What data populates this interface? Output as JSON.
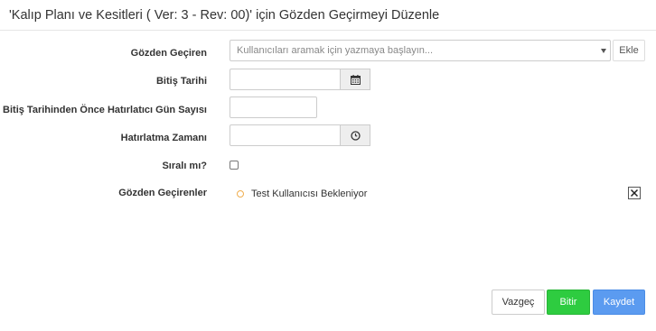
{
  "modal": {
    "title": "'Kalıp Planı ve Kesitleri ( Ver: 3 - Rev: 00)' için Gözden Geçirmeyi Düzenle"
  },
  "form": {
    "reviewer_label": "Gözden Geçiren",
    "reviewer_placeholder": "Kullanıcıları aramak için yazmaya başlayın...",
    "add_label": "Ekle",
    "end_date_label": "Bitiş Tarihi",
    "end_date_value": "",
    "reminder_days_label": "Bitiş Tarihinden Önce Hatırlatıcı Gün Sayısı",
    "reminder_days_value": "",
    "reminder_time_label": "Hatırlatma Zamanı",
    "reminder_time_value": "",
    "sequential_label": "Sıralı mı?",
    "sequential_checked": false,
    "reviewers_label": "Gözden Geçirenler"
  },
  "reviewers": [
    {
      "text": "Test Kullanıcısı Bekleniyor",
      "status_color": "#f0ad4e"
    }
  ],
  "buttons": {
    "cancel": "Vazgeç",
    "finish": "Bitir",
    "save": "Kaydet"
  },
  "icons": {
    "calendar": "calendar-icon",
    "clock": "clock-icon",
    "remove": "close-icon"
  },
  "colors": {
    "finish": "#2ecc40",
    "save": "#5b9bf0",
    "pending": "#f0ad4e"
  }
}
